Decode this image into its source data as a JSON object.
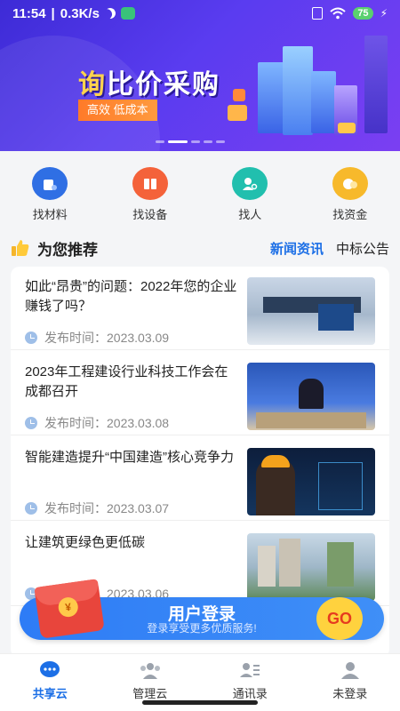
{
  "status": {
    "time": "11:54",
    "network": "0.3K/s",
    "battery": "75"
  },
  "banner": {
    "title_first": "询",
    "title_rest": "比价采购",
    "tagline": "高效  低成本"
  },
  "quick_actions": [
    {
      "label": "找材料",
      "icon": "materials-icon",
      "color": "#2f6fe4"
    },
    {
      "label": "找设备",
      "icon": "equipment-icon",
      "color": "#f4623a"
    },
    {
      "label": "找人",
      "icon": "people-search-icon",
      "color": "#21bfae"
    },
    {
      "label": "找资金",
      "icon": "funds-icon",
      "color": "#f7b92b"
    }
  ],
  "section": {
    "title": "为您推荐",
    "tab_news": "新闻资讯",
    "tab_bids": "中标公告"
  },
  "news": [
    {
      "title": "如此“昂贵”的问题：2022年您的企业赚钱了吗？",
      "date": "发布时间：2023.03.09"
    },
    {
      "title": "2023年工程建设行业科技工作会在成都召开",
      "date": "发布时间：2023.03.08"
    },
    {
      "title": "智能建造提升“中国建造”核心竞争力",
      "date": "发布时间：2023.03.07"
    },
    {
      "title": "让建筑更绿色更低碳",
      "date": "发布时间：2023.03.06"
    }
  ],
  "login": {
    "title": "用户登录",
    "subtitle": "登录享受更多优质服务!",
    "go": "GO"
  },
  "tabs": [
    {
      "label": "共享云",
      "icon": "chat-bubble-icon"
    },
    {
      "label": "管理云",
      "icon": "group-icon"
    },
    {
      "label": "通讯录",
      "icon": "contacts-icon"
    },
    {
      "label": "未登录",
      "icon": "user-icon"
    }
  ]
}
